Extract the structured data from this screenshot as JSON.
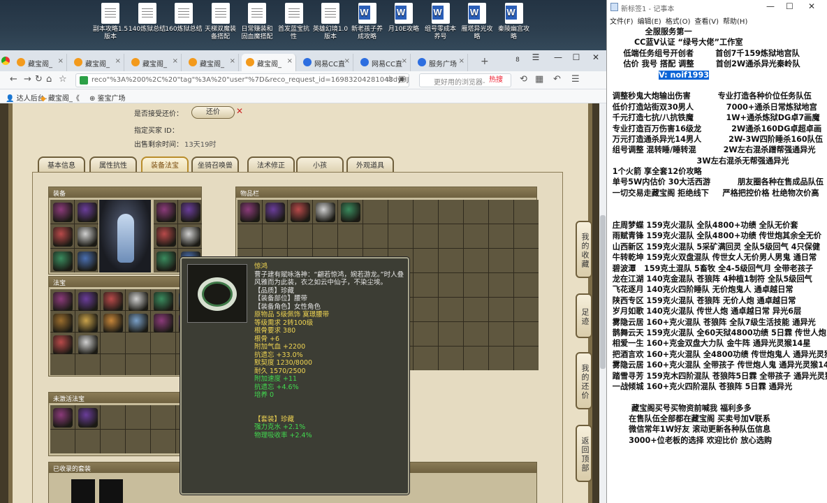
{
  "desktop": {
    "icons": [
      {
        "label": "副本攻略1.5\n版本",
        "type": "txt"
      },
      {
        "label": "140炼狱总结",
        "type": "txt"
      },
      {
        "label": "160炼狱总结",
        "type": "txt"
      },
      {
        "label": "天梯双魔装\n备搭配",
        "type": "txt"
      },
      {
        "label": "日常赚装和\n固血魔搭配",
        "type": "txt"
      },
      {
        "label": "首发蓝宝抗\n性",
        "type": "txt"
      },
      {
        "label": "英雄幻境1.0\n版本",
        "type": "txt"
      },
      {
        "label": "新老孩子养\n成攻略",
        "type": "word"
      },
      {
        "label": "月10E攻略",
        "type": "word"
      },
      {
        "label": "组号零成本\n养号",
        "type": "word"
      },
      {
        "label": "雁塔异光攻\n略",
        "type": "word"
      },
      {
        "label": "秦陵幽宫攻\n略",
        "type": "word"
      }
    ]
  },
  "browser": {
    "tabs": [
      {
        "label": "藏宝阁_",
        "active": false,
        "color": "orange"
      },
      {
        "label": "藏宝阁_",
        "active": false,
        "color": "orange"
      },
      {
        "label": "藏宝阁_",
        "active": false,
        "color": "orange"
      },
      {
        "label": "藏宝阁_",
        "active": false,
        "color": "orange"
      },
      {
        "label": "藏宝阁_",
        "active": true,
        "color": "orange"
      },
      {
        "label": "网易CC直",
        "active": false,
        "color": "blue"
      },
      {
        "label": "网易CC直",
        "active": false,
        "color": "blue"
      },
      {
        "label": "服务广场",
        "active": false,
        "color": "blue"
      }
    ],
    "tab_count": "8",
    "url": "reco\"%3A%200%2C%20\"tag\"%3A%20\"user\"%7D&reco_request_id=16983204281048dyHJ",
    "search_placeholder": "更好用的浏览器-",
    "hot_label": "热搜",
    "bookmarks": [
      "达人后台-",
      "藏宝阁_《",
      "鉴宝广场"
    ]
  },
  "cbg": {
    "accept_counter_label": "是否接受还价：",
    "counter_button": "还价",
    "buyer_id_label": "指定买家 ID：",
    "remaining_label": "出售剩余时间：",
    "remaining_value": "13天19时",
    "tabs": [
      "基本信息",
      "属性抗性",
      "装备法宝",
      "坐骑召唤兽",
      "法术修正",
      "小孩",
      "外观道具"
    ],
    "active_tab": "装备法宝",
    "sections": {
      "equip": "装备",
      "fabao": "法宝",
      "unactivated_fabao": "未激活法宝",
      "inventory": "物品栏",
      "collected_sets": "已收录的套装"
    },
    "side_buttons": [
      "我的收藏",
      "足迹",
      "我的还价",
      "返回顶部"
    ]
  },
  "tooltip": {
    "name": "惊鸿",
    "desc": "曹子建有赋咏洛神：“翩若惊鸿，婉若游龙。”时人叠风雅而为此装，衣之如云中仙子，不染尘埃。",
    "lines": [
      {
        "t": "【品质】珍藏",
        "c": "wht"
      },
      {
        "t": "【装备部位】腰带",
        "c": "wht"
      },
      {
        "t": "【装备角色】女性角色",
        "c": "wht"
      },
      {
        "t": "原物品 5级佩饰 寞璟腰带",
        "c": "yel"
      },
      {
        "t": "等级需求 2转100级",
        "c": "yel"
      },
      {
        "t": "根骨要求 380",
        "c": "yel"
      },
      {
        "t": "根骨 +6",
        "c": "yel"
      },
      {
        "t": "附加气血 +2200",
        "c": "yel"
      },
      {
        "t": "抗遗忘 +33.0%",
        "c": "yel"
      },
      {
        "t": "默契度 1230/8000",
        "c": "yel"
      },
      {
        "t": "耐久 1570/2500",
        "c": "yel"
      },
      {
        "t": "附加速度 +11",
        "c": "grn"
      },
      {
        "t": "抗遗忘 +4.6%",
        "c": "grn"
      },
      {
        "t": "培养 0",
        "c": "grn"
      },
      {
        "t": "",
        "c": "wht"
      },
      {
        "t": "",
        "c": "wht"
      },
      {
        "t": "【套装】珍藏",
        "c": "yel"
      },
      {
        "t": "强力克水 +2.1%",
        "c": "grn"
      },
      {
        "t": "物理吸收率 +2.4%",
        "c": "grn"
      }
    ]
  },
  "notepad": {
    "title": "新标签1 - 记事本",
    "menu": [
      "文件(F)",
      "编辑(E)",
      "格式(O)",
      "查看(V)",
      "帮助(H)"
    ],
    "lines": [
      "              全服服务第一",
      "          CC蓝V认证 “绿号大佬”工作室",
      "      低端任务组号开创者        首创7千159炼狱地宫队",
      "      估价 我号 搭配 调整        首创2W通杀异光秦岭队",
      "                   V: noif1993",
      "",
      "  调整秒鬼大炮输出伤害          专业打造各种价位任务队伍",
      "  低价打造站街双30男人            7000+通杀日常炼狱地宫",
      "  千元打造七抗/八抗铁魔            1W+通杀炼狱DG卓7画魔",
      "  专业打造百万伤害16级龙           2W通杀160DG卓超卓画",
      "  万元打造通杀异光14男人          2W-3W四阶睡杀160队伍",
      "  组号调整 混转睡/睡转混          2W左右混杀蹭帮强通异光",
      "                                 3W左右混杀无帮强通异光",
      "  1个火箭 享全套12价攻略",
      "  单号5W内估价 30大活西游          朋友圈各种在售成品队伍",
      "  一切交易走藏宝阁 拒绝线下     严格把控价格 杜绝物次价高",
      "",
      "",
      "  庄周梦蝶 159克火混队 全队4800+功绩 全队无价套",
      "  雨赋青锋 159克火混队 全队4800+功绩 传世炮其余全无价",
      "  山西新区 159克火混队 5采矿满回灵 全队5级回气 4只保健",
      "  牛转乾坤 159克火双盘混队 传世女人无价男人男鬼 通日常",
      "  碧波潭   159克土混队 5畜牧 全4-5级回气月 全带老孩子",
      "  龙在江湖 140克金混队 苍狼阵 4种植1制符 全队5级回气",
      "  飞花逐月 140克火四阶睡队 无价炮鬼人 通卓越日常",
      "  陕西专区 159克火混队 苍狼阵 无价人炮 通卓越日常",
      "  岁月如歌 140克火混队 传世人炮 通卓越日常 异光6层",
      "  雾隐云居 160+克火混队 苍狼阵 全队7级生活技能 通异光",
      "  鹊舞云天 159克火混队 全60天狱4800功绩 5日霖 传世人炮",
      "  相爱一生 160+克金双盘大力队 金牛阵 通异光灵猴14星",
      "  把酒言欢 160+克火混队 全4800功绩 传世炮鬼人 通异光灵猴",
      "  雾隐云居 160+克火混队 全带孩子 传世炮人鬼 通异光灵猴14",
      "  踏雪寻芳 159克木四阶混队 苍狼阵5日霖 全带孩子 通异光灵猴",
      "  一战倾城 160+克火四阶混队 苍狼阵 5日霖 通异光",
      "",
      "         藏宝阁买号买物资前喊我 福利多多",
      "        在售队伍全部都在藏宝阁 买卖号加V联系",
      "        微信常年1W好友 滚动更新各种队伍信息",
      "        3000+位老板的选择 欢迎比价 放心选购"
    ],
    "selected_text": "V: noif1993"
  }
}
